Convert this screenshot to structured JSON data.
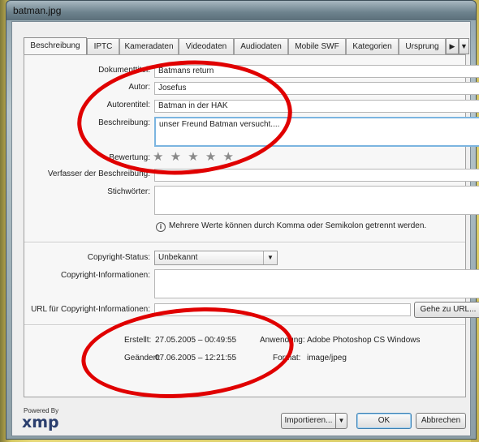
{
  "window": {
    "title": "batman.jpg"
  },
  "tabs": [
    {
      "label": "Beschreibung"
    },
    {
      "label": "IPTC"
    },
    {
      "label": "Kameradaten"
    },
    {
      "label": "Videodaten"
    },
    {
      "label": "Audiodaten"
    },
    {
      "label": "Mobile SWF"
    },
    {
      "label": "Kategorien"
    },
    {
      "label": "Ursprung"
    }
  ],
  "tab_scroll": {
    "right": "▶",
    "menu": "▼"
  },
  "description": {
    "doc_title_label": "Dokumenttitel:",
    "doc_title_value": "Batmans return",
    "author_label": "Autor:",
    "author_value": "Josefus",
    "author_title_label": "Autorentitel:",
    "author_title_value": "Batman in der HAK",
    "description_label": "Beschreibung:",
    "description_value": "unser Freund Batman versucht....",
    "rating_label": "Bewertung:",
    "rating_stars": "★ ★ ★ ★ ★",
    "desc_writer_label": "Verfasser der Beschreibung:",
    "desc_writer_value": "",
    "keywords_label": "Stichwörter:",
    "keywords_value": "",
    "keywords_hint_icon": "i",
    "keywords_hint": "Mehrere Werte können durch Komma oder Semikolon getrennt werden."
  },
  "copyright": {
    "status_label": "Copyright-Status:",
    "status_value": "Unbekannt",
    "status_arrow": "▼",
    "info_label": "Copyright-Informationen:",
    "info_value": "",
    "url_label": "URL für Copyright-Informationen:",
    "url_value": "",
    "goto_url_button": "Gehe zu URL..."
  },
  "file_info": {
    "created_label": "Erstellt:",
    "created_value": "27.05.2005 – 00:49:55",
    "modified_label": "Geändert:",
    "modified_value": "07.06.2005 – 12:21:55",
    "application_label": "Anwendung:",
    "application_value": "Adobe Photoshop CS Windows",
    "format_label": "Format:",
    "format_value": "image/jpeg"
  },
  "footer": {
    "powered_by": "Powered By",
    "logo": "xmp",
    "import_button": "Importieren...",
    "import_arrow": "▼",
    "ok_button": "OK",
    "cancel_button": "Abbrechen"
  }
}
